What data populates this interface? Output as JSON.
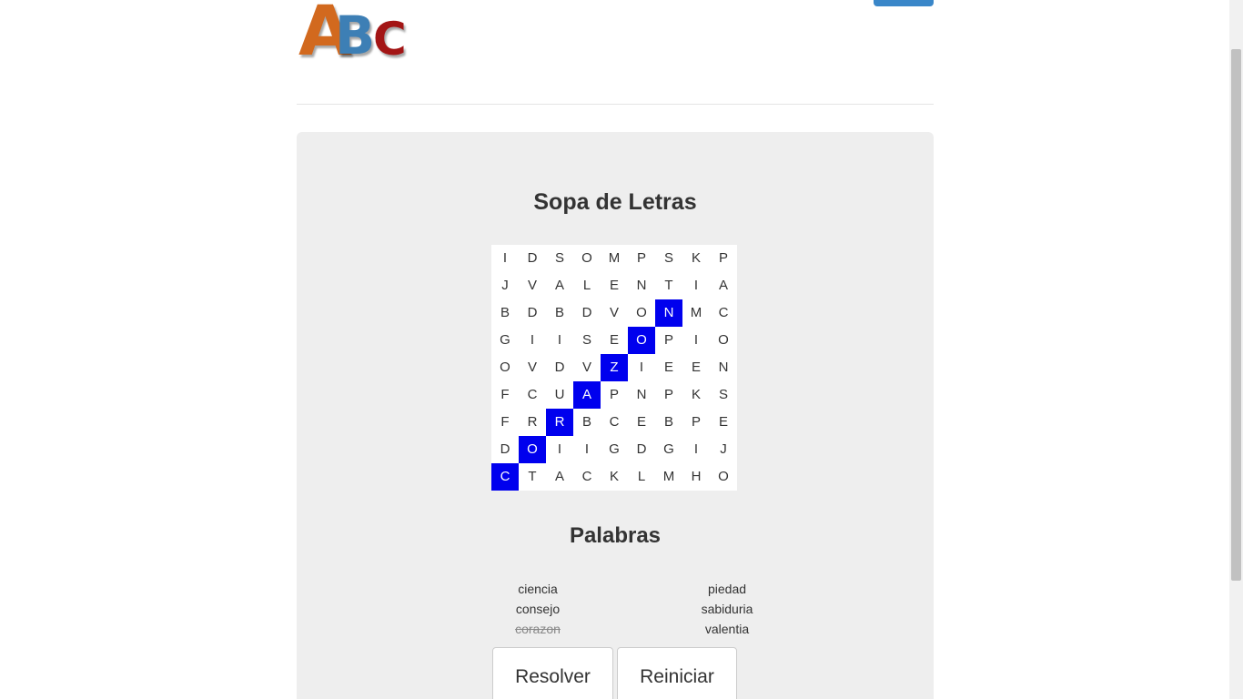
{
  "logo": {
    "letters": [
      "A",
      "B",
      "C"
    ]
  },
  "game": {
    "title": "Sopa de Letras",
    "grid": [
      [
        "I",
        "D",
        "S",
        "O",
        "M",
        "P",
        "S",
        "K",
        "P"
      ],
      [
        "J",
        "V",
        "A",
        "L",
        "E",
        "N",
        "T",
        "I",
        "A"
      ],
      [
        "B",
        "D",
        "B",
        "D",
        "V",
        "O",
        "N",
        "M",
        "C"
      ],
      [
        "G",
        "I",
        "I",
        "S",
        "E",
        "O",
        "P",
        "I",
        "O"
      ],
      [
        "O",
        "V",
        "D",
        "V",
        "Z",
        "I",
        "E",
        "E",
        "N"
      ],
      [
        "F",
        "C",
        "U",
        "A",
        "P",
        "N",
        "P",
        "K",
        "S"
      ],
      [
        "F",
        "R",
        "R",
        "B",
        "C",
        "E",
        "B",
        "P",
        "E"
      ],
      [
        "D",
        "O",
        "I",
        "I",
        "G",
        "D",
        "G",
        "I",
        "J"
      ],
      [
        "C",
        "T",
        "A",
        "C",
        "K",
        "L",
        "M",
        "H",
        "O"
      ]
    ],
    "highlighted": [
      [
        2,
        6
      ],
      [
        3,
        5
      ],
      [
        4,
        4
      ],
      [
        5,
        3
      ],
      [
        6,
        2
      ],
      [
        7,
        1
      ],
      [
        8,
        0
      ]
    ],
    "highlight_color": "#0000ee"
  },
  "words": {
    "title": "Palabras",
    "left": [
      {
        "text": "ciencia",
        "found": false
      },
      {
        "text": "consejo",
        "found": false
      },
      {
        "text": "corazon",
        "found": true
      }
    ],
    "right": [
      {
        "text": "piedad",
        "found": false
      },
      {
        "text": "sabiduria",
        "found": false
      },
      {
        "text": "valentia",
        "found": false
      }
    ]
  },
  "buttons": {
    "solve": "Resolver",
    "reset": "Reiniciar"
  }
}
